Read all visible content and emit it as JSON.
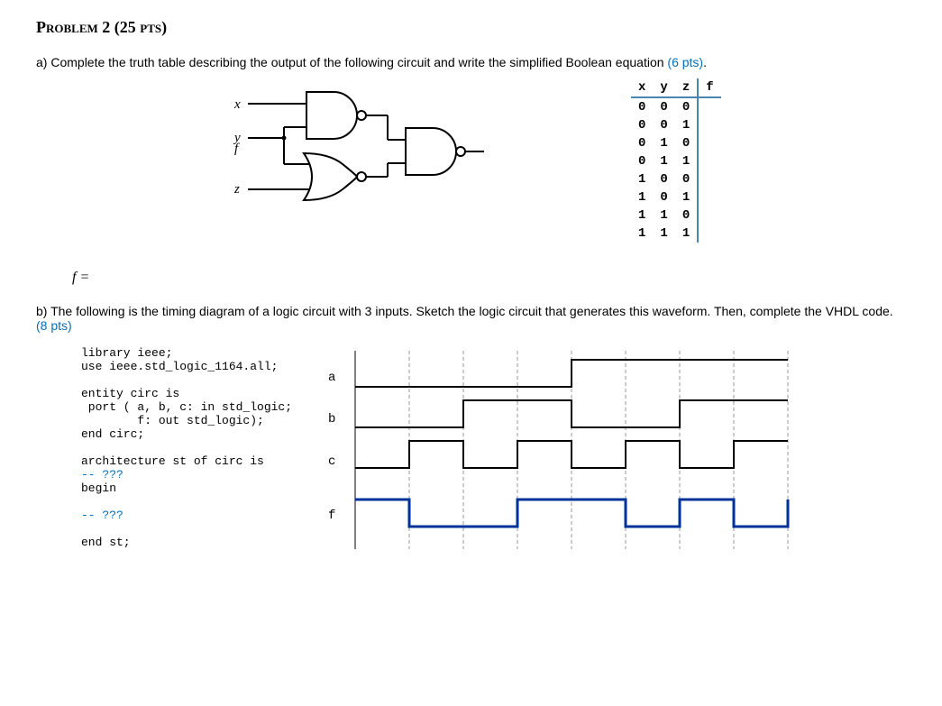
{
  "problem_title": "Problem 2 (25 pts)",
  "part_a": {
    "label": "a)",
    "text": "Complete the truth table describing the output of the following circuit and write the simplified Boolean equation ",
    "pts": "(6 pts)",
    "period": ".",
    "inputs": {
      "x": "x",
      "y": "y",
      "z": "z"
    },
    "output": "f",
    "equation": "f =",
    "truth_table": {
      "headers": [
        "x",
        "y",
        "z",
        "f"
      ],
      "rows": [
        [
          "0",
          "0",
          "0",
          ""
        ],
        [
          "0",
          "0",
          "1",
          ""
        ],
        [
          "0",
          "1",
          "0",
          ""
        ],
        [
          "0",
          "1",
          "1",
          ""
        ],
        [
          "1",
          "0",
          "0",
          ""
        ],
        [
          "1",
          "0",
          "1",
          ""
        ],
        [
          "1",
          "1",
          "0",
          ""
        ],
        [
          "1",
          "1",
          "1",
          ""
        ]
      ]
    }
  },
  "part_b": {
    "label": "b)",
    "text": "The following is the timing diagram of a logic circuit with 3 inputs. Sketch the logic circuit that generates this waveform. Then, complete the VHDL code. ",
    "pts": "(8 pts)",
    "vhdl": {
      "line1": "library ieee;",
      "line2": "use ieee.std_logic_1164.all;",
      "line3": "",
      "line4": "entity circ is",
      "line5": " port ( a, b, c: in std_logic;",
      "line6": "        f: out std_logic);",
      "line7": "end circ;",
      "line8": "",
      "line9": "architecture st of circ is",
      "line10": "-- ???",
      "line11": "begin",
      "line12": "",
      "line13": "-- ???",
      "line14": "",
      "line15": "end st;"
    },
    "signals": {
      "a": "a",
      "b": "b",
      "c": "c",
      "f": "f"
    }
  }
}
